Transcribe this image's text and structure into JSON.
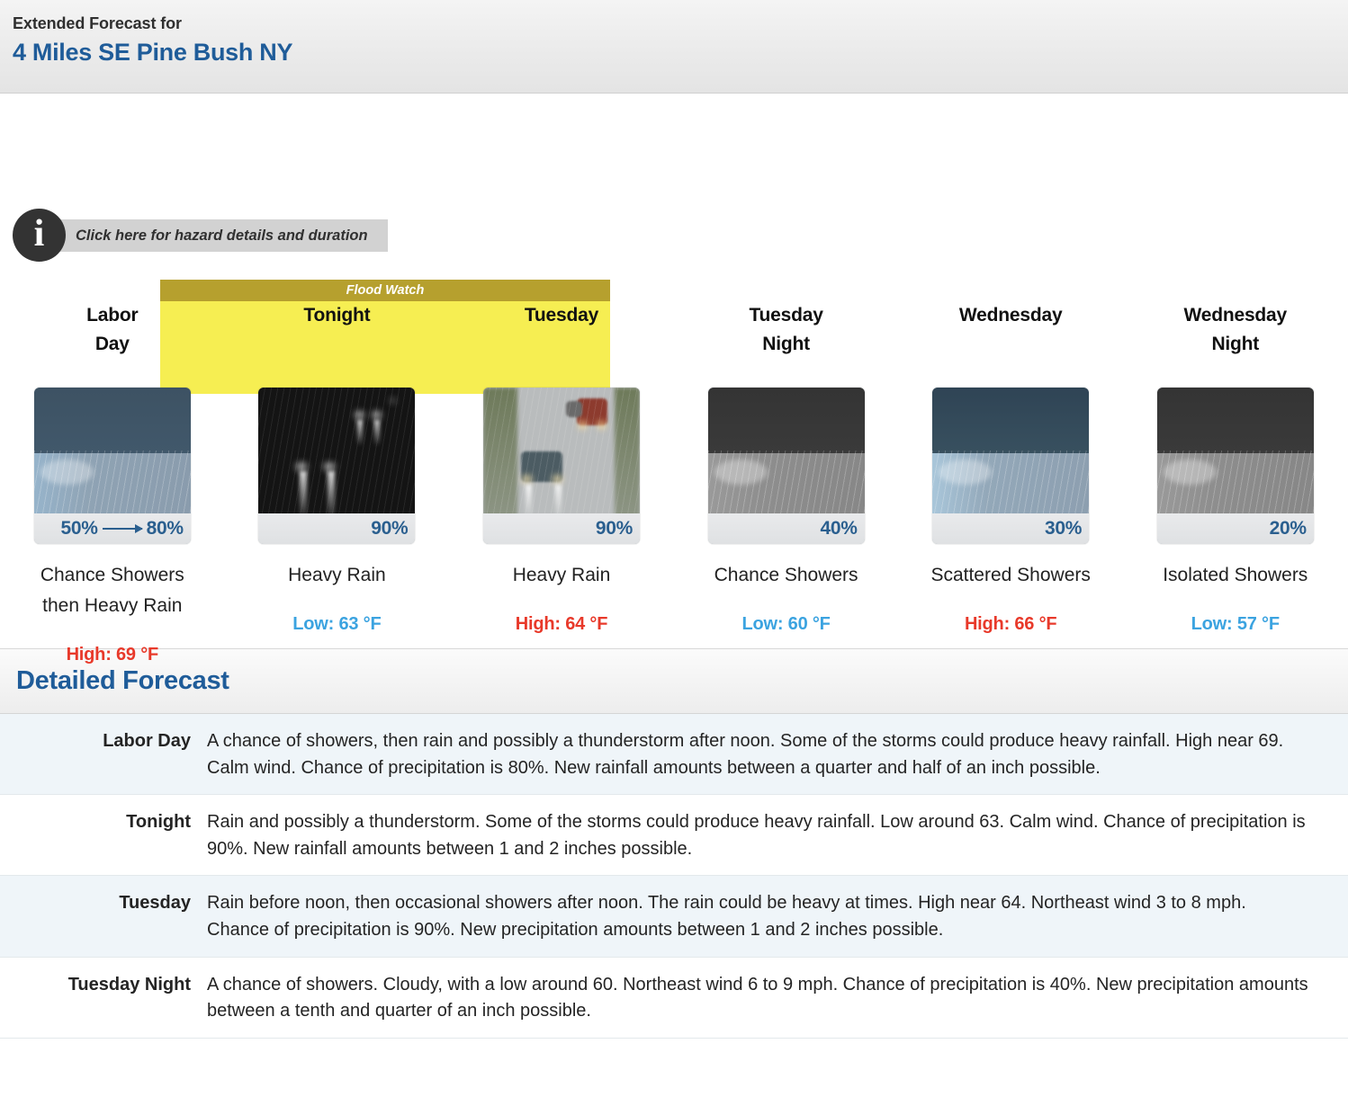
{
  "header": {
    "subtitle": "Extended Forecast for",
    "location": "4 Miles SE Pine Bush NY"
  },
  "hazard": {
    "info_icon": "info-icon",
    "click_text": "Click here for hazard details and duration",
    "banner_label": "Flood Watch",
    "banner_color": "#f6ee52",
    "banner_title_color": "#b6a02e"
  },
  "colors": {
    "link_blue": "#1f5c99",
    "high_red": "#e8392a",
    "low_blue": "#3ba3e0",
    "pct_blue": "#2a5f8f",
    "row_alt": "#eff5f9"
  },
  "forecast": {
    "periods": [
      {
        "name_line1": "Labor",
        "name_line2": "Day",
        "icon": "rain-day-icon",
        "pct_from": "50%",
        "pct_to": "80%",
        "pct_has_arrow": true,
        "condition": "Chance Showers then Heavy Rain",
        "temp_label": "High: 69 °F",
        "temp_type": "high"
      },
      {
        "name_line1": "Tonight",
        "name_line2": "",
        "icon": "heavy-rain-night-road-icon",
        "pct_from": "90%",
        "pct_to": "",
        "pct_has_arrow": false,
        "condition": "Heavy Rain",
        "temp_label": "Low: 63 °F",
        "temp_type": "low"
      },
      {
        "name_line1": "Tuesday",
        "name_line2": "",
        "icon": "heavy-rain-day-road-icon",
        "pct_from": "90%",
        "pct_to": "",
        "pct_has_arrow": false,
        "condition": "Heavy Rain",
        "temp_label": "High: 64 °F",
        "temp_type": "high"
      },
      {
        "name_line1": "Tuesday",
        "name_line2": "Night",
        "icon": "rain-night-icon",
        "pct_from": "40%",
        "pct_to": "",
        "pct_has_arrow": false,
        "condition": "Chance Showers",
        "temp_label": "Low: 60 °F",
        "temp_type": "low"
      },
      {
        "name_line1": "Wednesday",
        "name_line2": "",
        "icon": "rain-day-icon",
        "pct_from": "30%",
        "pct_to": "",
        "pct_has_arrow": false,
        "condition": "Scattered Showers",
        "temp_label": "High: 66 °F",
        "temp_type": "high"
      },
      {
        "name_line1": "Wednesday",
        "name_line2": "Night",
        "icon": "rain-night-icon",
        "pct_from": "20%",
        "pct_to": "",
        "pct_has_arrow": false,
        "condition": "Isolated Showers",
        "temp_label": "Low: 57 °F",
        "temp_type": "low"
      }
    ]
  },
  "detailed": {
    "heading": "Detailed Forecast",
    "rows": [
      {
        "label": "Labor Day",
        "text": "A chance of showers, then rain and possibly a thunderstorm after noon. Some of the storms could produce heavy rainfall. High near 69. Calm wind. Chance of precipitation is 80%. New rainfall amounts between a quarter and half of an inch possible."
      },
      {
        "label": "Tonight",
        "text": "Rain and possibly a thunderstorm. Some of the storms could produce heavy rainfall. Low around 63. Calm wind. Chance of precipitation is 90%. New rainfall amounts between 1 and 2 inches possible."
      },
      {
        "label": "Tuesday",
        "text": "Rain before noon, then occasional showers after noon. The rain could be heavy at times. High near 64. Northeast wind 3 to 8 mph. Chance of precipitation is 90%. New precipitation amounts between 1 and 2 inches possible."
      },
      {
        "label": "Tuesday Night",
        "text": "A chance of showers. Cloudy, with a low around 60. Northeast wind 6 to 9 mph. Chance of precipitation is 40%. New precipitation amounts between a tenth and quarter of an inch possible."
      }
    ]
  }
}
